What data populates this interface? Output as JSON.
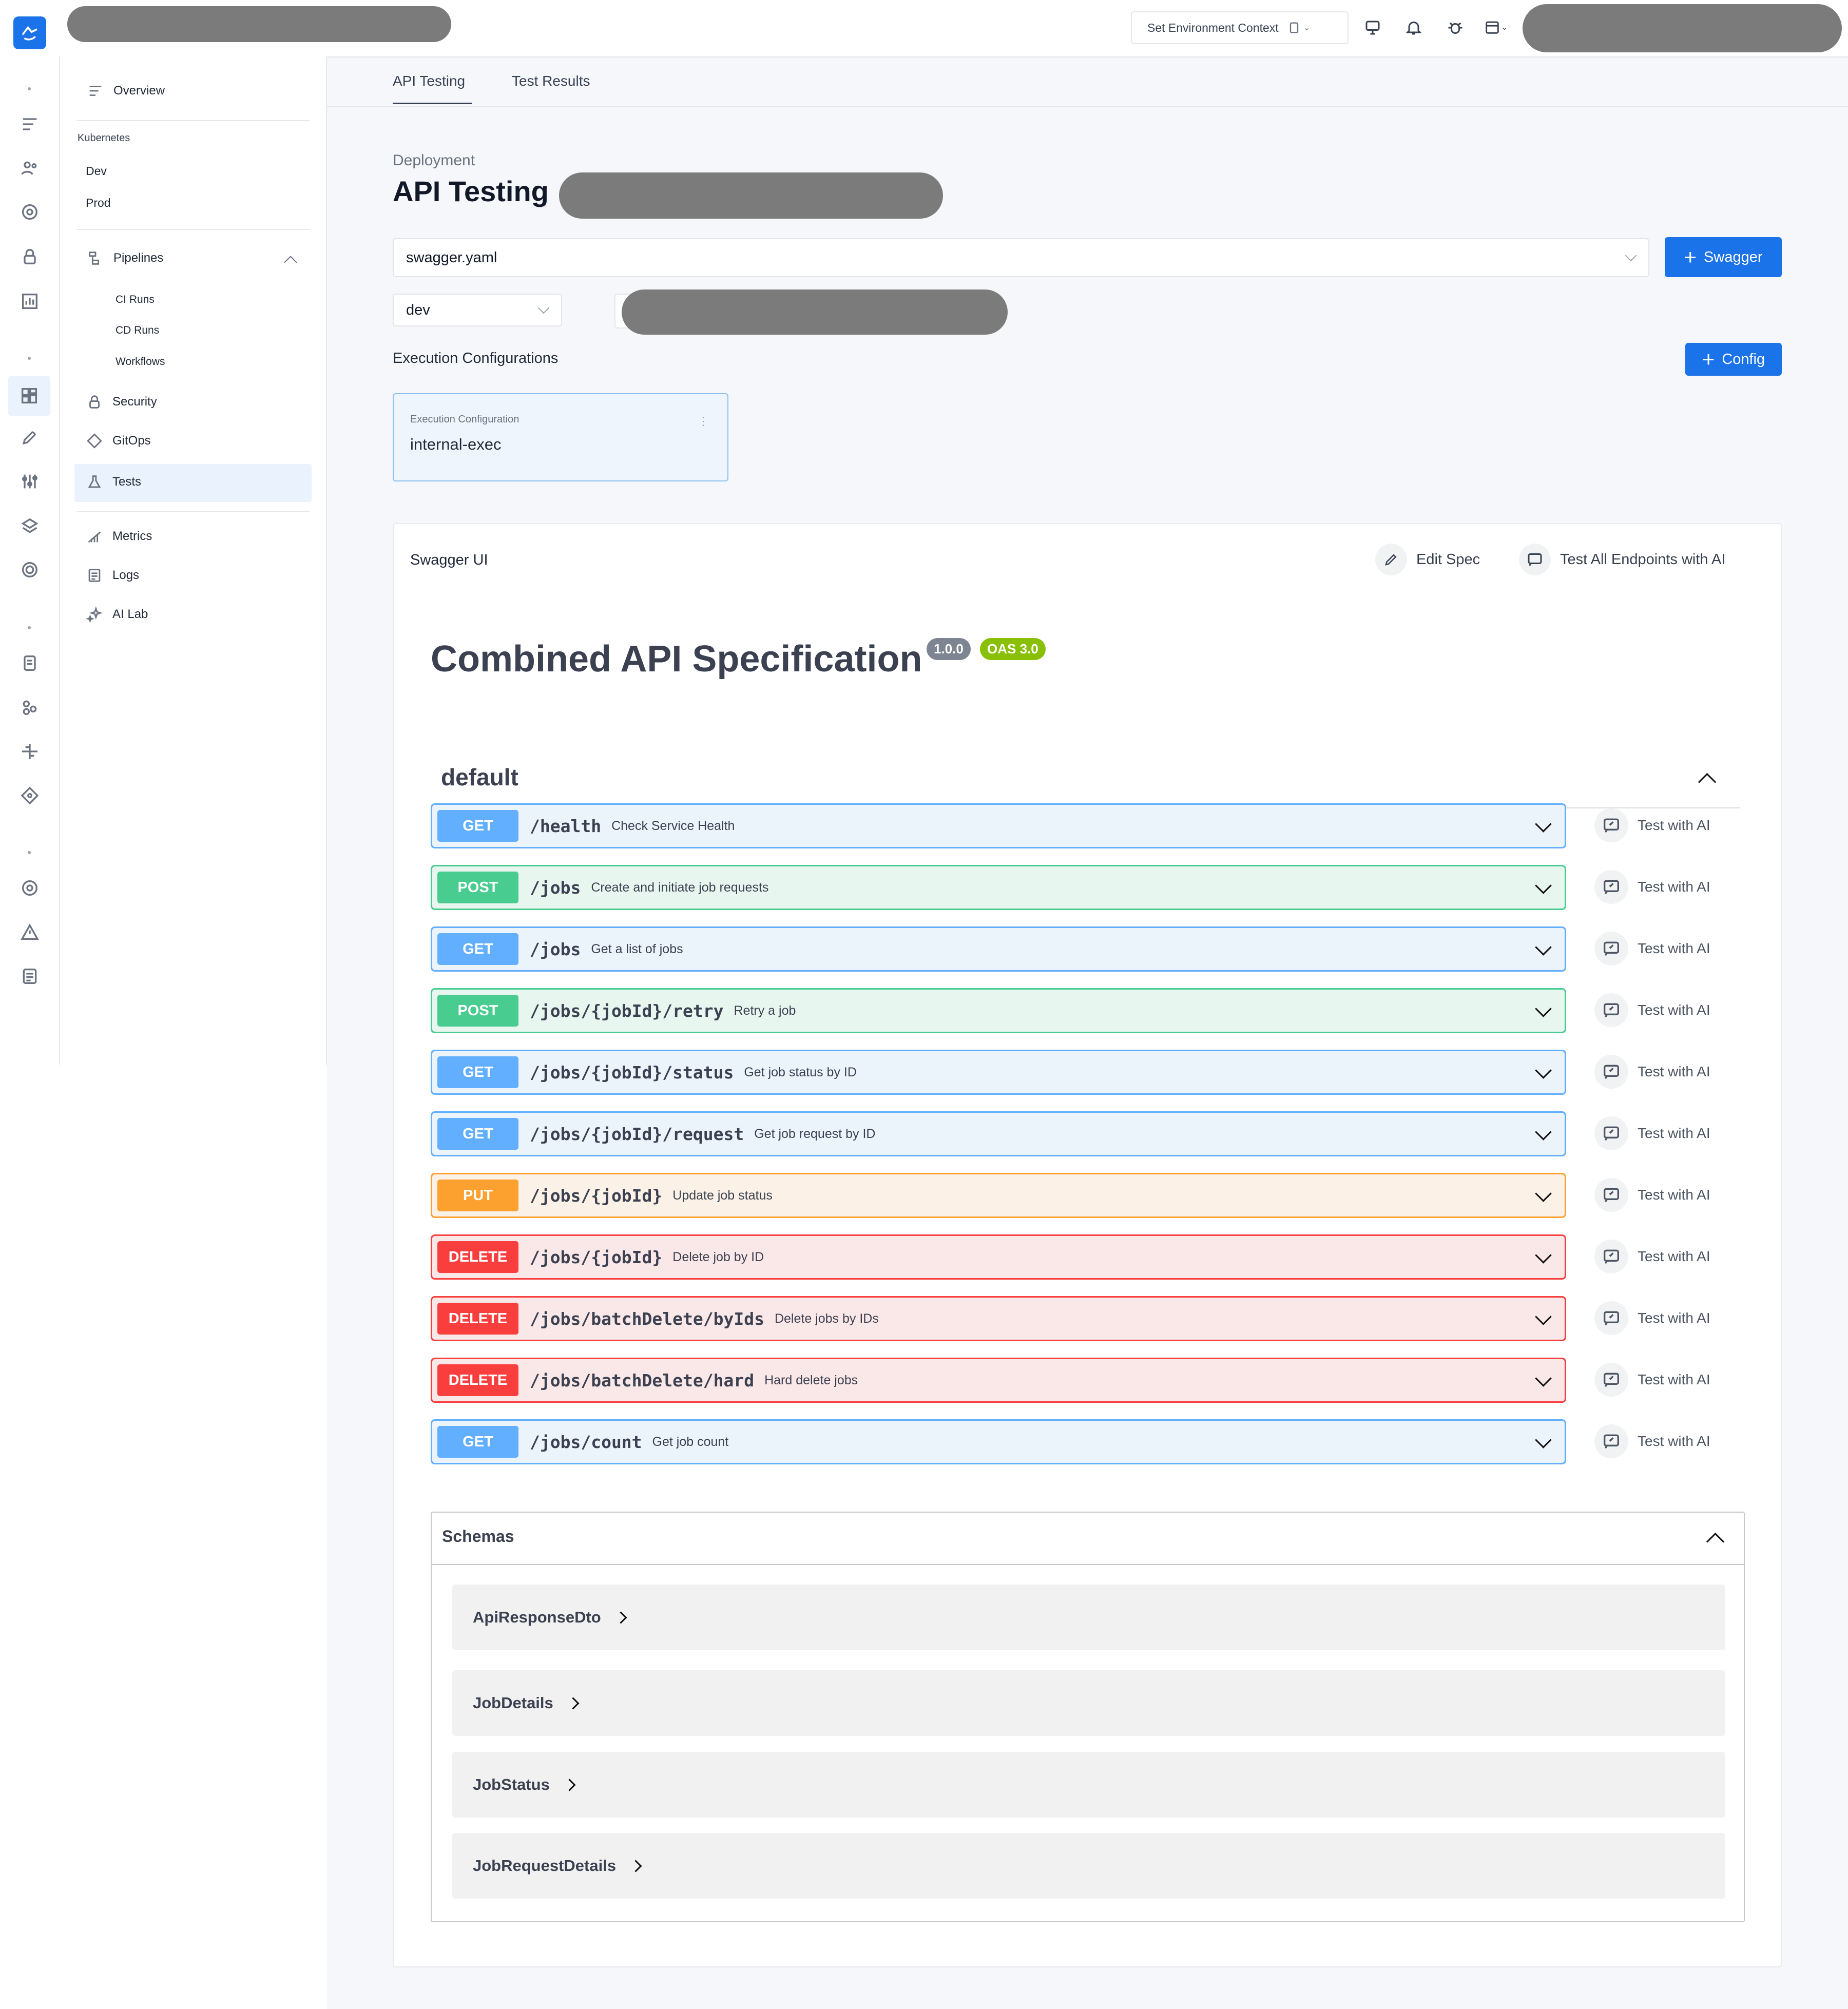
{
  "header": {
    "env_context_label": "Set Environment Context",
    "icons": [
      "app-logo-icon",
      "monitor-icon",
      "bell-icon",
      "bug-icon",
      "calendar-icon"
    ]
  },
  "rail": {
    "icons": [
      "menu-icon",
      "users-icon",
      "gear-icon",
      "lock-icon",
      "chart-icon",
      "dashboard-icon",
      "rocket-icon",
      "sliders-icon",
      "layers-icon",
      "radar-icon",
      "document-icon",
      "apps-icon",
      "plugins-icon",
      "git-icon",
      "settings-circle-icon",
      "warning-icon",
      "notes-icon"
    ]
  },
  "nav": {
    "overview": "Overview",
    "kubernetes_heading": "Kubernetes",
    "dev": "Dev",
    "prod": "Prod",
    "pipelines": "Pipelines",
    "ci_runs": "CI Runs",
    "cd_runs": "CD Runs",
    "workflows": "Workflows",
    "security": "Security",
    "gitops": "GitOps",
    "tests": "Tests",
    "metrics": "Metrics",
    "logs": "Logs",
    "ai_lab": "AI Lab"
  },
  "tabs": [
    {
      "label": "API Testing",
      "active": true
    },
    {
      "label": "Test Results",
      "active": false
    }
  ],
  "page": {
    "eyebrow": "Deployment",
    "title": "API Testing",
    "spec_select_value": "swagger.yaml",
    "swagger_button": "Swagger",
    "env_select_value": "dev",
    "exec_configs_heading": "Execution Configurations",
    "config_button": "Config",
    "config_card": {
      "label": "Execution Configuration",
      "name": "internal-exec"
    }
  },
  "swagger": {
    "panel_title": "Swagger UI",
    "edit_spec": "Edit Spec",
    "test_all": "Test All Endpoints with AI",
    "api_title": "Combined API Specification",
    "version_badge": "1.0.0",
    "oas_badge": "OAS 3.0",
    "tag_name": "default",
    "test_with_ai_label": "Test with AI",
    "operations": [
      {
        "method": "GET",
        "path": "/health",
        "summary": "Check Service Health"
      },
      {
        "method": "POST",
        "path": "/jobs",
        "summary": "Create and initiate job requests"
      },
      {
        "method": "GET",
        "path": "/jobs",
        "summary": "Get a list of jobs"
      },
      {
        "method": "POST",
        "path": "/jobs/{jobId}/retry",
        "summary": "Retry a job"
      },
      {
        "method": "GET",
        "path": "/jobs/{jobId}/status",
        "summary": "Get job status by ID"
      },
      {
        "method": "GET",
        "path": "/jobs/{jobId}/request",
        "summary": "Get job request by ID"
      },
      {
        "method": "PUT",
        "path": "/jobs/{jobId}",
        "summary": "Update job status"
      },
      {
        "method": "DELETE",
        "path": "/jobs/{jobId}",
        "summary": "Delete job by ID"
      },
      {
        "method": "DELETE",
        "path": "/jobs/batchDelete/byIds",
        "summary": "Delete jobs by IDs"
      },
      {
        "method": "DELETE",
        "path": "/jobs/batchDelete/hard",
        "summary": "Hard delete jobs"
      },
      {
        "method": "GET",
        "path": "/jobs/count",
        "summary": "Get job count"
      }
    ],
    "schemas_title": "Schemas",
    "schemas": [
      "ApiResponseDto",
      "JobDetails",
      "JobStatus",
      "JobRequestDetails"
    ]
  },
  "colors": {
    "GET": {
      "badge": "#61affe",
      "bg": "#ebf3fb",
      "border": "#61affe"
    },
    "POST": {
      "badge": "#49cc90",
      "bg": "#e8f6f0",
      "border": "#49cc90"
    },
    "PUT": {
      "badge": "#fca130",
      "bg": "#fbf1e6",
      "border": "#fca130"
    },
    "DELETE": {
      "badge": "#f93e3e",
      "bg": "#fae7e7",
      "border": "#f93e3e"
    },
    "accent": "#1a73e8",
    "version_badge": "#7d8492",
    "oas_badge": "#89bf04"
  }
}
